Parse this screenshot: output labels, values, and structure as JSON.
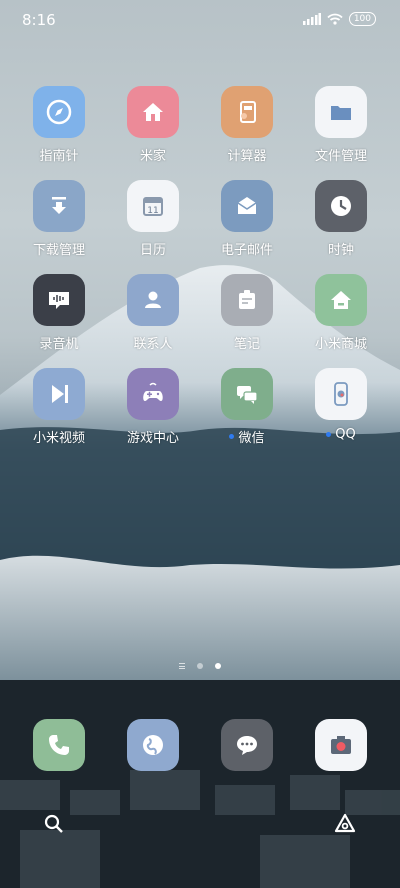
{
  "status_bar": {
    "time": "8:16",
    "battery": "100"
  },
  "apps": [
    {
      "label": "指南针",
      "icon": "compass-icon",
      "color": "#7fb2ea"
    },
    {
      "label": "米家",
      "icon": "home-icon",
      "color": "#ec8a98"
    },
    {
      "label": "计算器",
      "icon": "calculator-icon",
      "color": "#e0a172"
    },
    {
      "label": "文件管理",
      "icon": "folder-icon",
      "color": "#f3f5f8"
    },
    {
      "label": "下载管理",
      "icon": "download-icon",
      "color": "#8aa6c8"
    },
    {
      "label": "日历",
      "icon": "calendar-icon",
      "color": "#f3f5f8",
      "calendar_day": "11"
    },
    {
      "label": "电子邮件",
      "icon": "mail-icon",
      "color": "#7c9bbf"
    },
    {
      "label": "时钟",
      "icon": "clock-icon",
      "color": "#5d6169"
    },
    {
      "label": "录音机",
      "icon": "recorder-icon",
      "color": "#3b3f48"
    },
    {
      "label": "联系人",
      "icon": "contacts-icon",
      "color": "#8ea7cc"
    },
    {
      "label": "笔记",
      "icon": "notes-icon",
      "color": "#a9adb4"
    },
    {
      "label": "小米商城",
      "icon": "store-icon",
      "color": "#8fc29b"
    },
    {
      "label": "小米视频",
      "icon": "video-icon",
      "color": "#8eaad2"
    },
    {
      "label": "游戏中心",
      "icon": "gamepad-icon",
      "color": "#8d7fb8"
    },
    {
      "label": "微信",
      "icon": "wechat-icon",
      "color": "#7fae8c",
      "notification_dot": true
    },
    {
      "label": "QQ",
      "icon": "qq-icon",
      "color": "#f3f5f8",
      "notification_dot": true
    }
  ],
  "page_indicator": {
    "pages": 2,
    "active": 2
  },
  "dock": [
    {
      "icon": "phone-icon",
      "color": "#8fbd97"
    },
    {
      "icon": "browser-icon",
      "color": "#8fa9cf"
    },
    {
      "icon": "messages-icon",
      "color": "#5d6168"
    },
    {
      "icon": "camera-icon",
      "color": "#f3f5f8"
    }
  ],
  "bottom_bar": {
    "left_icon": "search-icon",
    "right_icon": "assistant-icon"
  }
}
